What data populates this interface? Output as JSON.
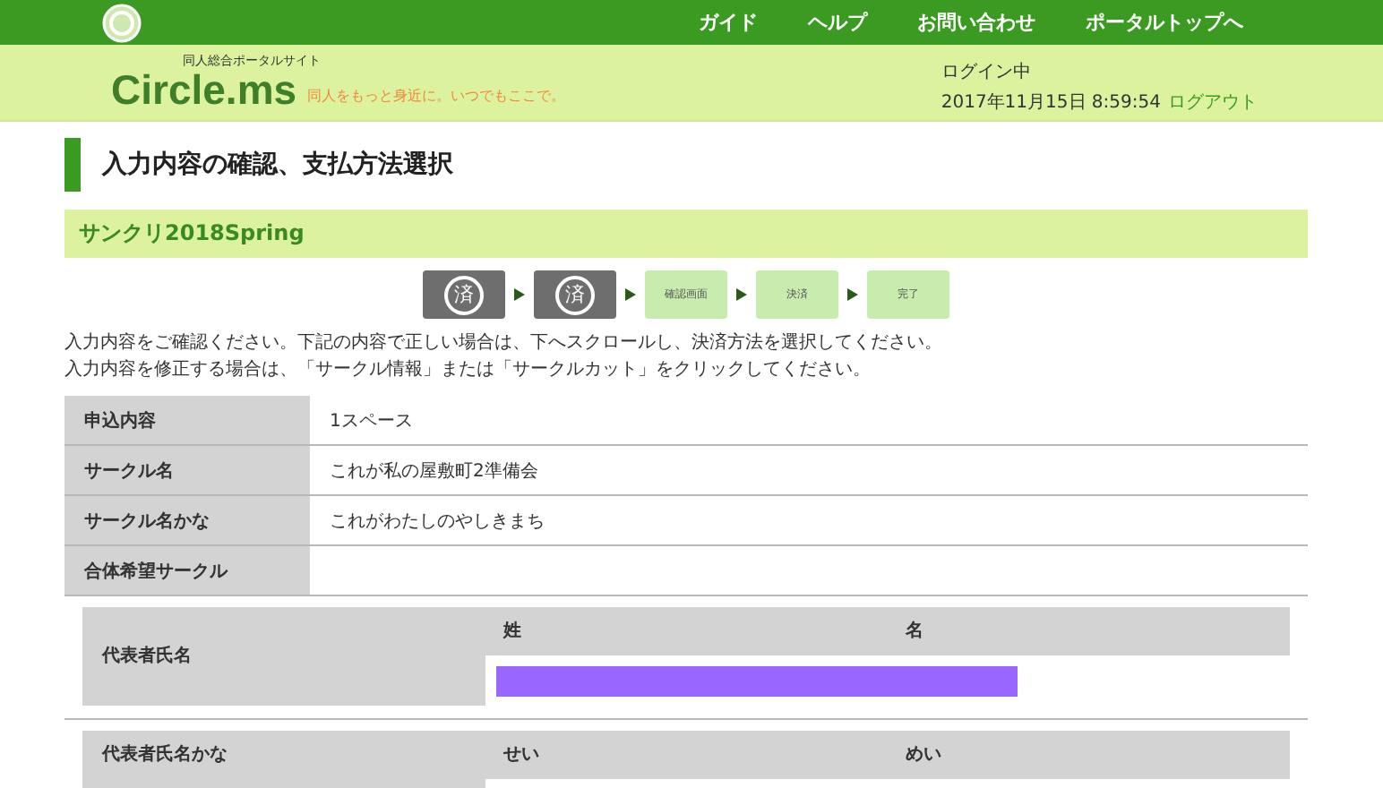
{
  "nav": {
    "items": [
      "ガイド",
      "ヘルプ",
      "お問い合わせ",
      "ポータルトップへ"
    ]
  },
  "brand": {
    "tagline_small": "同人総合ポータルサイト",
    "logo": "Circle.ms",
    "slogan": "同人をもっと身近に。いつでもここで。"
  },
  "session": {
    "status": "ログイン中",
    "datetime": "2017年11月15日 8:59:54",
    "logout": "ログアウト"
  },
  "page_title": "入力内容の確認、支払方法選択",
  "event_name": "サンクリ2018Spring",
  "steps": [
    {
      "kind": "done",
      "label": "済"
    },
    {
      "kind": "done",
      "label": "済"
    },
    {
      "kind": "todo",
      "label": "確認画面"
    },
    {
      "kind": "todo",
      "label": "決済"
    },
    {
      "kind": "todo",
      "label": "完了"
    }
  ],
  "instructions": [
    "入力内容をご確認ください。下記の内容で正しい場合は、下へスクロールし、決済方法を選択してください。",
    "入力内容を修正する場合は、「サークル情報」または「サークルカット」をクリックしてください。"
  ],
  "details": [
    {
      "label": "申込内容",
      "value": "1スペース"
    },
    {
      "label": "サークル名",
      "value": "これが私の屋敷町2準備会"
    },
    {
      "label": "サークル名かな",
      "value": "これがわたしのやしきまち"
    },
    {
      "label": "合体希望サークル"
    }
  ],
  "name_blocks": [
    {
      "label": "代表者氏名",
      "column_1": "姓",
      "column_2": "名",
      "redacted": true
    },
    {
      "label": "代表者氏名かな",
      "column_1": "せい",
      "column_2": "めい"
    }
  ]
}
